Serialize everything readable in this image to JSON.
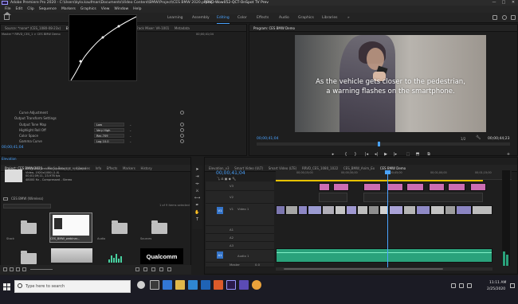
{
  "window": {
    "title": "Adobe Premiere Pro 2020 - C:\\Users\\kylo.kaufman\\Documents\\Video Content\\BMW\\Project\\CES BMW 2020.prproj",
    "center_title": "RRVD-Wow052-QCT-OnSpot TV Prev",
    "min": "—",
    "max": "□",
    "close": "✕"
  },
  "menu": [
    "File",
    "Edit",
    "Clip",
    "Sequence",
    "Markers",
    "Graphics",
    "View",
    "Window",
    "Help"
  ],
  "workspaces": [
    "Learning",
    "Assembly",
    "Editing",
    "Color",
    "Effects",
    "Audio",
    "Graphics",
    "Libraries",
    "»"
  ],
  "workspace_active_index": 2,
  "effect_controls": {
    "tabs": [
      "Source: *none* (CES_1080-08-23x)",
      "Effect Controls",
      "Audio Clip Mixer",
      "Audio Track Mixer: VA-1001",
      "Metadata"
    ],
    "active_tab_index": 1,
    "time": "00;00;41;04",
    "rows": [
      {
        "label": "Curve Adjustment",
        "value": "",
        "arrow": ""
      },
      {
        "label": "Output Transform Settings",
        "value": "",
        "arrow": ""
      },
      {
        "label": "Output Tone Map",
        "value": "Low",
        "arrow": "⌄"
      },
      {
        "label": "Highlight Roll Off",
        "value": "Very High",
        "arrow": "⌄"
      },
      {
        "label": "Color Space",
        "value": "Rec.709",
        "arrow": "⌄"
      },
      {
        "label": "Gamma Curve",
        "value": "Log 10.0",
        "arrow": "⌄"
      }
    ]
  },
  "program": {
    "tab": "Program: CES BMW Demo",
    "caption_line1": "As the vehicle gets closer to the pedestrian,",
    "caption_line2": "a warning flashes on the smartphone.",
    "timecode_left": "00;00;41;04",
    "fit": "1/2",
    "timecode_right": "00;00;44;23",
    "transport": [
      "▸",
      "{",
      "}",
      "|◂",
      "◂|",
      "▶",
      "|▸",
      "⬚",
      "⬒",
      "⧉",
      "+"
    ]
  },
  "project": {
    "tabs": [
      "Project: CES BMW 2020",
      "Media Browser",
      "Libraries",
      "Info",
      "Effects",
      "Markers",
      "History"
    ],
    "info_lines": [
      "CES_BMW_webinar_update_1_1_9(M).mp4",
      "Video, 1920x1080 (1.0)",
      "00;01;09;11, 23.976 fps",
      "48000 Hz - Compressed - Stereo"
    ],
    "bin_label": "CES BMW (Wireless)",
    "item_count": "1 of 9 items selected",
    "thumbs": [
      "Stock",
      "CES_BMW_webinar...",
      "Audio",
      "Sources",
      "Sequence"
    ],
    "qualcomm": "Qualcomm"
  },
  "timeline": {
    "tabs": [
      "Elevation_v3",
      "Smart Video (ULT)",
      "Smart Video (LTE)",
      "RRVD_CES_1080_1022",
      "CES_BMW_Anim_Ex",
      "CES BMW Demo"
    ],
    "active_tab_index": 5,
    "timecode": "00;00;41;04",
    "ruler": [
      "00;00;15;00",
      "00;00;30;00",
      "00;00;45;00",
      "00;01;00;00",
      "00;01;15;00"
    ],
    "tracks": {
      "v3": "V3",
      "v2": "V2",
      "v1": "V1",
      "a1": "A1",
      "a2": "A2",
      "a3": "A3",
      "master": "Master"
    },
    "v1_track_name": "Video 1",
    "a1_track_name": "Audio 1",
    "master_value": "0.0"
  },
  "taskbar": {
    "search_placeholder": "Type here to search",
    "time": "11:11 AM",
    "date": "2/25/2020"
  }
}
